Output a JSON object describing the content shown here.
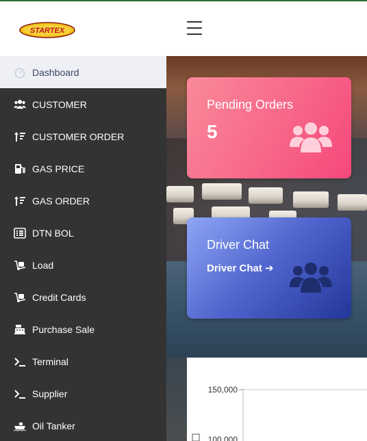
{
  "header": {
    "logo_text": "STARTEX",
    "menu_icon": "hamburger-menu-icon"
  },
  "sidebar": {
    "items": [
      {
        "label": "Dashboard",
        "icon": "speedometer-icon",
        "active": true
      },
      {
        "label": "CUSTOMER",
        "icon": "users-icon"
      },
      {
        "label": "CUSTOMER ORDER",
        "icon": "sort-amount-icon"
      },
      {
        "label": "GAS PRICE",
        "icon": "gas-pump-icon"
      },
      {
        "label": "GAS ORDER",
        "icon": "sort-amount-icon"
      },
      {
        "label": "DTN BOL",
        "icon": "list-alt-icon"
      },
      {
        "label": "Load",
        "icon": "dolly-icon"
      },
      {
        "label": "Credit Cards",
        "icon": "dolly-icon"
      },
      {
        "label": "Purchase Sale",
        "icon": "cash-register-icon"
      },
      {
        "label": "Terminal",
        "icon": "terminal-icon"
      },
      {
        "label": "Supplier",
        "icon": "terminal-icon"
      },
      {
        "label": "Oil Tanker",
        "icon": "ship-icon"
      }
    ]
  },
  "cards": {
    "pending": {
      "title": "Pending Orders",
      "value": "5",
      "icon": "users-icon",
      "color": "#f86a8a"
    },
    "chat": {
      "title": "Driver Chat",
      "link": "Driver Chat",
      "icon": "users-icon",
      "color": "#4e63cc"
    }
  },
  "chart": {
    "tick_150": "150,000",
    "tick_100": "100,000"
  },
  "colors": {
    "sidebar_bg": "#333333",
    "active_item_bg": "#eef0f6",
    "top_border": "#2e6b30"
  }
}
